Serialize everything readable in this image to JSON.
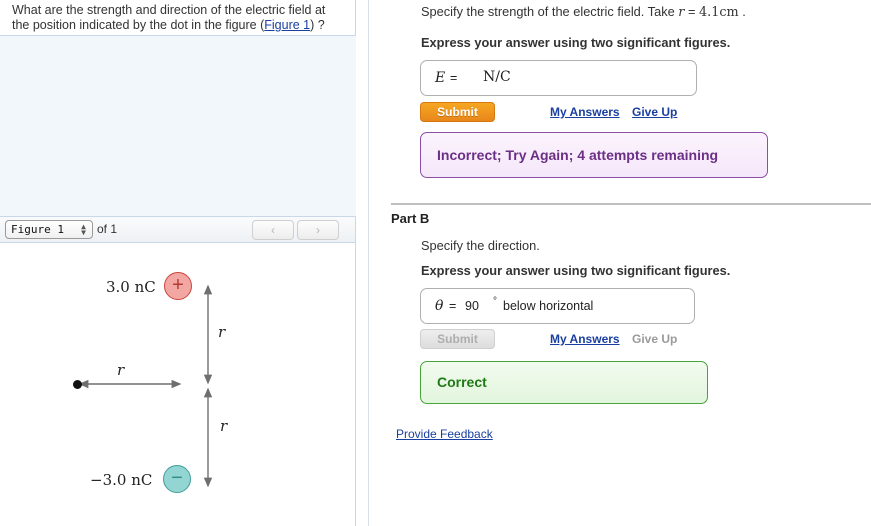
{
  "left_panel": {
    "question": {
      "line1": "What are the strength and direction of the electric field at",
      "line2_pre": "the position indicated by the dot in the figure (",
      "figure_link": "Figure 1",
      "line2_post": ") ?"
    },
    "figure_toolbar": {
      "selected_figure": "Figure 1",
      "of_label": "of 1",
      "prev_icon": "chevron-left-icon",
      "next_icon": "chevron-right-icon",
      "prev_glyph": "‹",
      "next_glyph": "›"
    },
    "figure": {
      "positive_charge_label": "3.0 nC",
      "positive_sign": "+",
      "negative_charge_label": "−3.0 nC",
      "negative_sign": "−",
      "distance_label_vertical_top": "r",
      "distance_label_vertical_bottom": "r",
      "distance_label_horizontal": "r",
      "positive_charge_color": "#f3a7a2",
      "positive_charge_border": "#c9453f",
      "negative_charge_color": "#93d5d2",
      "negative_charge_border": "#3f9e9a",
      "field_point_marker": "dot"
    }
  },
  "right_panel": {
    "part_a": {
      "prompt_pre": "Specify the strength of the electric field. Take ",
      "prompt_var": "r",
      "prompt_eq": " = ",
      "prompt_val": "4.1cm",
      "prompt_post": " .",
      "instruction": "Express your answer using two significant figures.",
      "answer": {
        "symbol": "E",
        "equals": "=",
        "value": "",
        "placeholder": "",
        "unit": "N/C"
      },
      "submit_label": "Submit",
      "submit_enabled": "true",
      "my_answers_label": "My Answers",
      "give_up_label": "Give Up",
      "feedback_banner": "Incorrect; Try Again; 4 attempts remaining",
      "feedback_banner_color": "#6b2f86"
    },
    "part_b": {
      "title": "Part B",
      "prompt": "Specify the direction.",
      "instruction": "Express your answer using two significant figures.",
      "answer": {
        "symbol": "θ",
        "equals": "=",
        "value": "90",
        "degree": "°",
        "suffix": "below horizontal"
      },
      "submit_label": "Submit",
      "submit_enabled": "false",
      "my_answers_label": "My Answers",
      "give_up_label": "Give Up",
      "feedback_banner": "Correct",
      "feedback_banner_color": "#1f7a14"
    },
    "provide_feedback_label": "Provide Feedback"
  }
}
